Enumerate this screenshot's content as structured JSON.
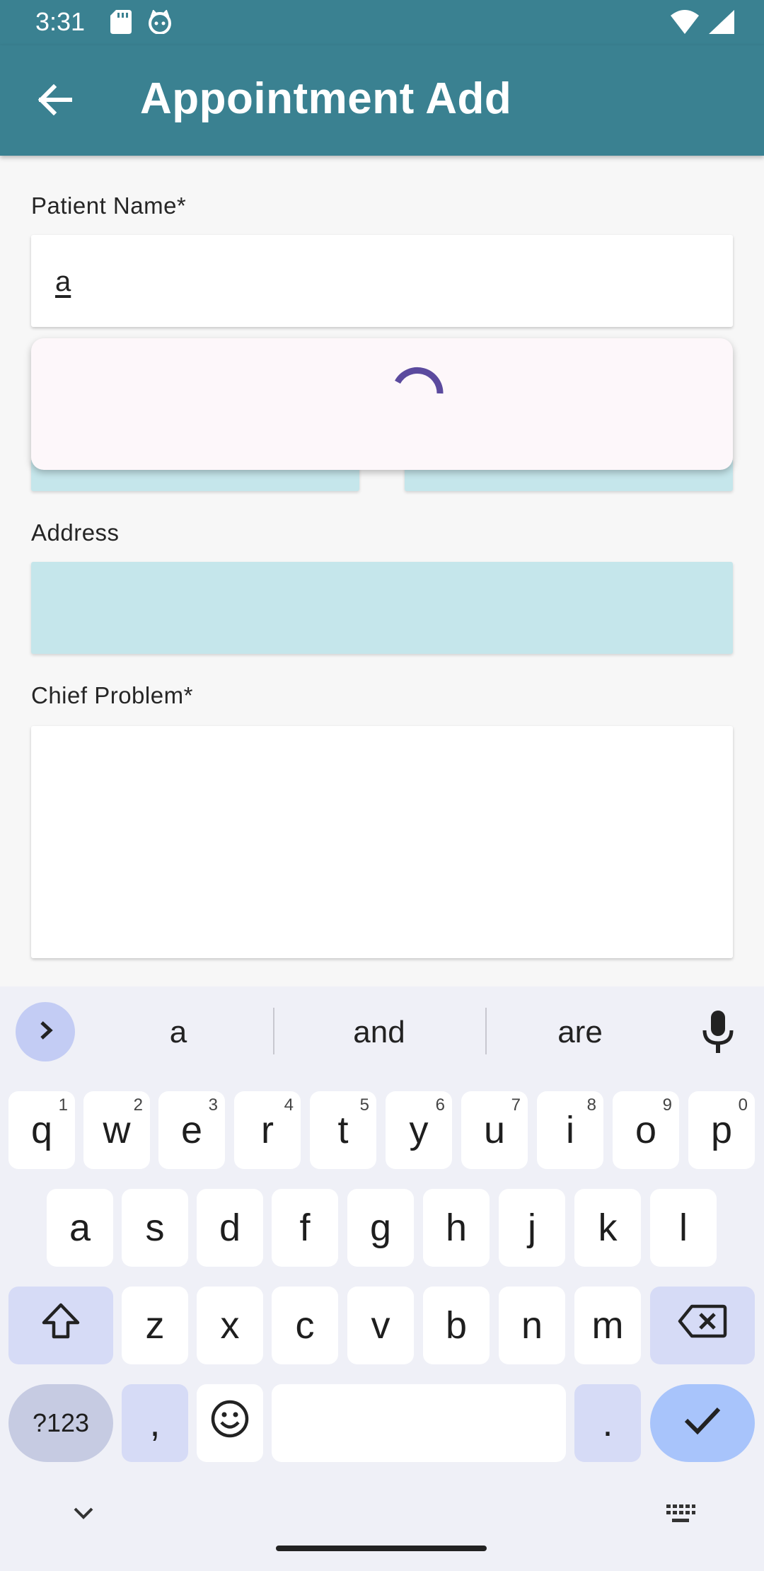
{
  "status_bar": {
    "time": "3:31",
    "icons": [
      "sd-card-icon",
      "cat-icon",
      "wifi-icon",
      "signal-icon"
    ]
  },
  "app_bar": {
    "title": "Appointment Add",
    "back_icon": "arrow-back-icon"
  },
  "form": {
    "patient_name": {
      "label": "Patient Name*",
      "value": "a"
    },
    "address": {
      "label": "Address",
      "value": ""
    },
    "chief_problem": {
      "label": "Chief Problem*",
      "value": ""
    }
  },
  "popup": {
    "state": "loading"
  },
  "keyboard": {
    "suggestions": [
      "a",
      "and",
      "are"
    ],
    "row1": [
      {
        "k": "q",
        "h": "1"
      },
      {
        "k": "w",
        "h": "2"
      },
      {
        "k": "e",
        "h": "3"
      },
      {
        "k": "r",
        "h": "4"
      },
      {
        "k": "t",
        "h": "5"
      },
      {
        "k": "y",
        "h": "6"
      },
      {
        "k": "u",
        "h": "7"
      },
      {
        "k": "i",
        "h": "8"
      },
      {
        "k": "o",
        "h": "9"
      },
      {
        "k": "p",
        "h": "0"
      }
    ],
    "row2": [
      "a",
      "s",
      "d",
      "f",
      "g",
      "h",
      "j",
      "k",
      "l"
    ],
    "row3": [
      "z",
      "x",
      "c",
      "v",
      "b",
      "n",
      "m"
    ],
    "symbols_label": "?123",
    "comma": ",",
    "period": "."
  },
  "colors": {
    "primary": "#3a8191",
    "field_fill": "#c5e6eb",
    "spinner": "#5b4a9e",
    "keyboard_bg": "#eff0f7"
  }
}
